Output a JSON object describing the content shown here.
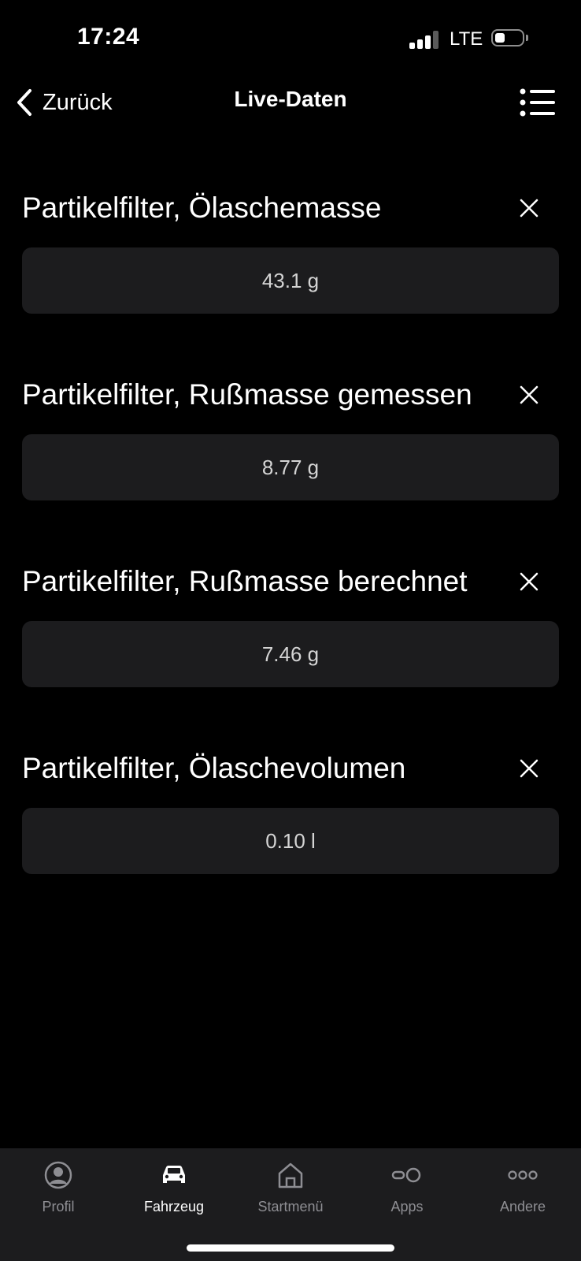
{
  "status_bar": {
    "time": "17:24",
    "network": "LTE",
    "icons": [
      "signal-icon",
      "battery-icon"
    ]
  },
  "nav": {
    "back_label": "Zurück",
    "title": "Live-Daten",
    "icons": [
      "chevron-left-icon",
      "list-menu-icon"
    ]
  },
  "items": [
    {
      "title": "Partikelfilter, Ölaschemasse",
      "value": "43.1 g"
    },
    {
      "title": "Partikelfilter, Rußmasse gemessen",
      "value": "8.77 g"
    },
    {
      "title": "Partikelfilter, Rußmasse berechnet",
      "value": "7.46 g"
    },
    {
      "title": "Partikelfilter, Ölaschevolumen",
      "value": "0.10 l"
    }
  ],
  "tabs": [
    {
      "label": "Profil",
      "icon": "profile-icon",
      "active": false
    },
    {
      "label": "Fahrzeug",
      "icon": "car-icon",
      "active": true
    },
    {
      "label": "Startmenü",
      "icon": "home-icon",
      "active": false
    },
    {
      "label": "Apps",
      "icon": "apps-icon",
      "active": false
    },
    {
      "label": "Andere",
      "icon": "more-icon",
      "active": false
    }
  ],
  "colors": {
    "background": "#000000",
    "card": "#1c1c1e",
    "text": "#ffffff",
    "tab_inactive": "#8e8e93"
  }
}
